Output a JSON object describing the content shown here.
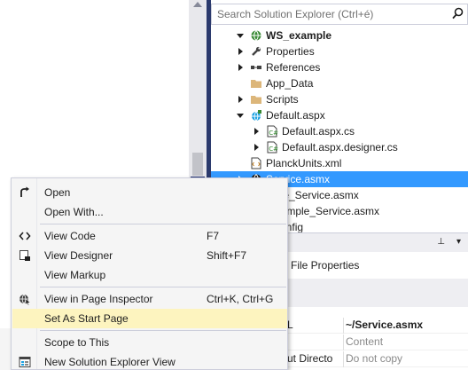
{
  "solution_explorer": {
    "search_placeholder": "Search Solution Explorer (Ctrl+é)",
    "tree": [
      {
        "label": "WS_example",
        "icon": "web-project-icon",
        "expander": "expanded",
        "bold": true
      },
      {
        "label": "Properties",
        "icon": "wrench-icon",
        "expander": "collapsed"
      },
      {
        "label": "References",
        "icon": "references-icon",
        "expander": "collapsed"
      },
      {
        "label": "App_Data",
        "icon": "folder-icon",
        "expander": "none"
      },
      {
        "label": "Scripts",
        "icon": "folder-icon",
        "expander": "collapsed"
      },
      {
        "label": "Default.aspx",
        "icon": "web-page-icon",
        "expander": "expanded"
      },
      {
        "label": "Default.aspx.cs",
        "icon": "csharp-file-icon",
        "expander": "collapsed"
      },
      {
        "label": "Default.aspx.designer.cs",
        "icon": "csharp-file-icon",
        "expander": "collapsed"
      },
      {
        "label": "PlanckUnits.xml",
        "icon": "xml-file-icon",
        "expander": "none"
      },
      {
        "label": "Service.asmx",
        "icon": "web-service-icon",
        "expander": "collapsed",
        "selected": true
      },
      {
        "label": "mple_Service.asmx",
        "icon": "web-service-icon",
        "expander": "none"
      },
      {
        "label": "y_Simple_Service.asmx",
        "icon": "web-service-icon",
        "expander": "none"
      },
      {
        "label": "b.config",
        "icon": "config-file-icon",
        "expander": "none"
      }
    ]
  },
  "properties": {
    "header_title": "",
    "object_label": "File Properties",
    "rows": [
      {
        "name": "L",
        "value": "~/Service.asmx",
        "style": "bold"
      },
      {
        "name": "",
        "value": "Content",
        "style": "muted"
      },
      {
        "name": "ut Directo",
        "value": "Do not copy",
        "style": "muted"
      }
    ]
  },
  "context_menu": {
    "items": [
      {
        "label": "Open",
        "shortcut": "",
        "icon": "open-arrow-icon"
      },
      {
        "label": "Open With...",
        "shortcut": "",
        "icon": ""
      },
      {
        "separator": true
      },
      {
        "label": "View Code",
        "shortcut": "F7",
        "icon": "code-brackets-icon"
      },
      {
        "label": "View Designer",
        "shortcut": "Shift+F7",
        "icon": "designer-icon"
      },
      {
        "label": "View Markup",
        "shortcut": "",
        "icon": ""
      },
      {
        "separator": true
      },
      {
        "label": "View in Page Inspector",
        "shortcut": "Ctrl+K, Ctrl+G",
        "icon": "page-inspector-icon"
      },
      {
        "label": "Set As Start Page",
        "shortcut": "",
        "icon": "",
        "highlighted": true
      },
      {
        "separator": true
      },
      {
        "label": "Scope to This",
        "shortcut": "",
        "icon": ""
      },
      {
        "label": "New Solution Explorer View",
        "shortcut": "",
        "icon": "new-view-icon"
      }
    ]
  },
  "colors": {
    "selection": "#3399ff",
    "menu_highlight": "#fdf4bf",
    "splitter": "#2b3a6d"
  }
}
